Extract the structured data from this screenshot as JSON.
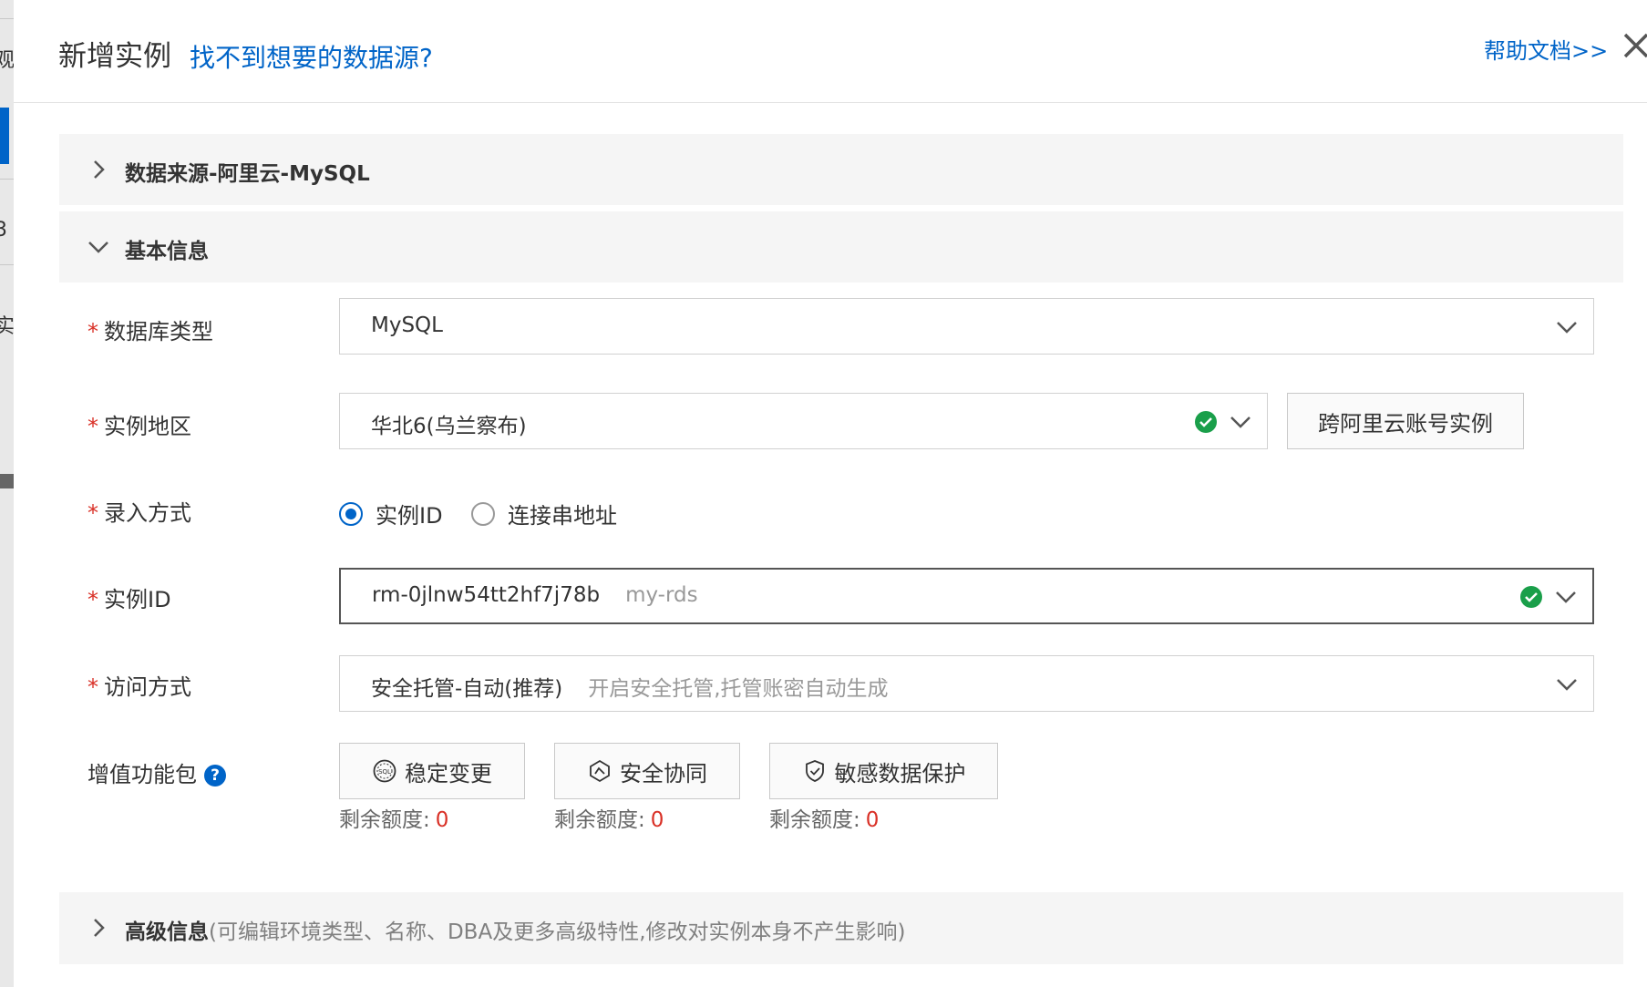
{
  "header": {
    "title": "新增实例",
    "title_link": "找不到想要的数据源?",
    "help_link": "帮助文档>>"
  },
  "sections": {
    "datasource": "数据来源-阿里云-MySQL",
    "basic": "基本信息",
    "advanced": "高级信息",
    "advanced_hint": "(可编辑环境类型、名称、DBA及更多高级特性,修改对实例本身不产生影响)"
  },
  "form": {
    "db_type": {
      "label": "数据库类型",
      "value": "MySQL"
    },
    "region": {
      "label": "实例地区",
      "value": "华北6(乌兰察布)",
      "cross_account_button": "跨阿里云账号实例"
    },
    "entry_mode": {
      "label": "录入方式",
      "options": [
        {
          "label": "实例ID",
          "selected": true
        },
        {
          "label": "连接串地址",
          "selected": false
        }
      ]
    },
    "instance_id": {
      "label": "实例ID",
      "value": "rm-0jlnw54tt2hf7j78b",
      "sub": "my-rds"
    },
    "access_mode": {
      "label": "访问方式",
      "value": "安全托管-自动(推荐)",
      "sub": "开启安全托管,托管账密自动生成"
    },
    "value_pack": {
      "label": "增值功能包",
      "help": "?",
      "items": [
        {
          "label": "稳定变更",
          "quota_label": "剩余额度:",
          "quota": "0"
        },
        {
          "label": "安全协同",
          "quota_label": "剩余额度:",
          "quota": "0"
        },
        {
          "label": "敏感数据保护",
          "quota_label": "剩余额度:",
          "quota": "0"
        }
      ]
    },
    "required_mark": "*"
  },
  "underlay": {
    "t1": "观",
    "t2": "3",
    "t3": "实"
  },
  "colors": {
    "accent": "#0064c8",
    "required": "#d93026",
    "success": "#1a9f4a"
  }
}
